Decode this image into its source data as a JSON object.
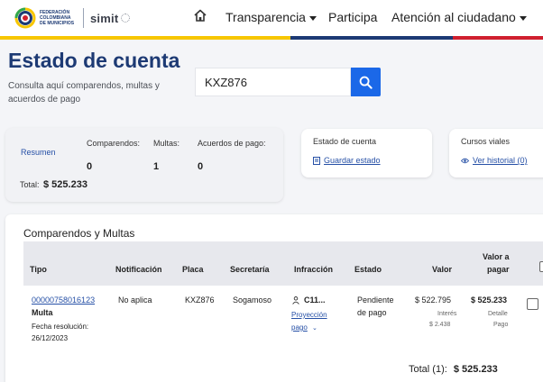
{
  "header": {
    "logo_text": "FEDERACIÓN COLOMBIANA DE MUNICIPIOS",
    "brand": "simit",
    "nav": [
      {
        "label": "Transparencia",
        "dropdown": true
      },
      {
        "label": "Participa",
        "dropdown": false
      },
      {
        "label": "Atención al ciudadano",
        "dropdown": true
      }
    ],
    "stripe_colors": [
      "#f7c600",
      "#1d3a74",
      "#d0202f"
    ]
  },
  "page": {
    "title": "Estado de cuenta",
    "subtitle": "Consulta aquí comparendos, multas y acuerdos de pago"
  },
  "search": {
    "value": "KXZ876",
    "icon": "search-icon"
  },
  "summary": {
    "resumen_label": "Resumen",
    "comparendos_label": "Comparendos:",
    "comparendos_value": "0",
    "multas_label": "Multas:",
    "multas_value": "1",
    "acuerdos_label": "Acuerdos de pago:",
    "acuerdos_value": "0",
    "total_label": "Total:",
    "total_value": "$ 525.233"
  },
  "estado_card": {
    "title": "Estado de cuenta",
    "link": "Guardar estado",
    "icon": "document-icon"
  },
  "cursos_card": {
    "title": "Cursos viales",
    "link": "Ver historial (0)",
    "icon": "eye-icon"
  },
  "table": {
    "title": "Comparendos y Multas",
    "headers": {
      "tipo": "Tipo",
      "notificacion": "Notificación",
      "placa": "Placa",
      "secretaria": "Secretaría",
      "infraccion": "Infracción",
      "estado": "Estado",
      "valor": "Valor",
      "valor_pagar_1": "Valor a",
      "valor_pagar_2": "pagar"
    },
    "rows": [
      {
        "numero": "00000758016123",
        "tipo": "Multa",
        "fecha_label": "Fecha resolución:",
        "fecha": "26/12/2023",
        "notificacion": "No aplica",
        "placa": "KXZ876",
        "secretaria": "Sogamoso",
        "infraccion": "C11...",
        "proyeccion_1": "Proyección",
        "proyeccion_2": "pago",
        "estado_1": "Pendiente",
        "estado_2": "de pago",
        "valor": "$ 522.795",
        "interes_label": "Interés",
        "interes": "$ 2.438",
        "valor_pagar": "$ 525.233",
        "detalle_1": "Detalle",
        "detalle_2": "Pago"
      }
    ],
    "footer_label": "Total (1):",
    "footer_value": "$ 525.233"
  }
}
